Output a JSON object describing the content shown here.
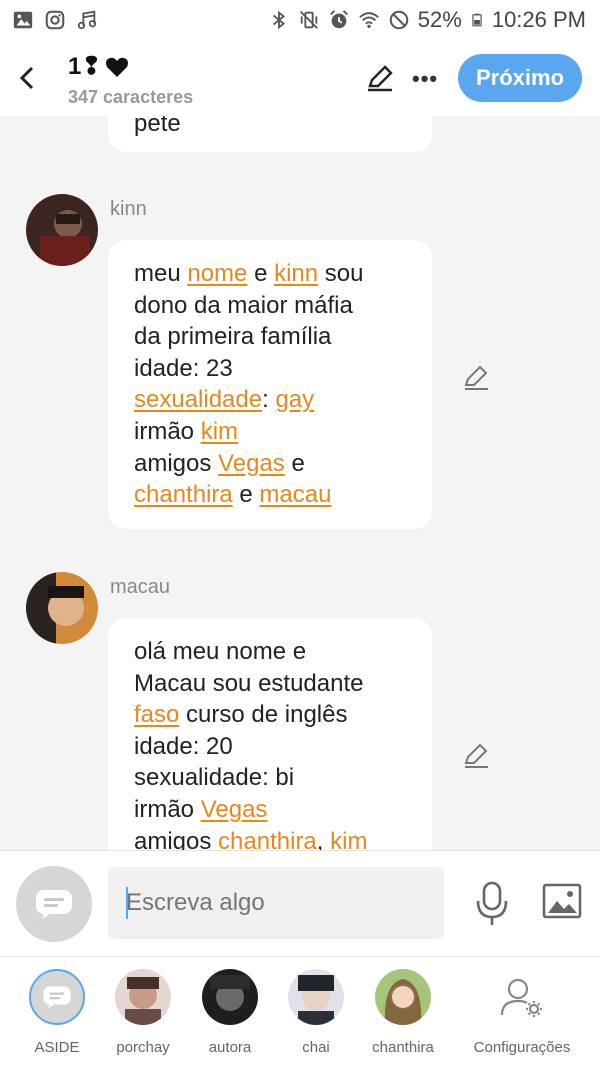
{
  "status_bar": {
    "battery": "52%",
    "time": "10:26 PM",
    "left_icons": [
      "image-icon",
      "instagram-icon",
      "music-icon"
    ],
    "right_icons": [
      "bluetooth-icon",
      "vibrate-icon",
      "alarm-icon",
      "wifi-icon",
      "no-disturb-icon",
      "battery-icon"
    ]
  },
  "header": {
    "title": "1❢",
    "subtitle": "347 caracteres",
    "next_label": "Próximo"
  },
  "messages": [
    {
      "author": "",
      "lines": [
        [
          {
            "t": "pete"
          }
        ]
      ]
    },
    {
      "author": "kinn",
      "lines": [
        [
          {
            "t": "meu "
          },
          {
            "t": "nome",
            "link": true
          },
          {
            "t": " e "
          },
          {
            "t": "kinn",
            "link": true
          },
          {
            "t": " sou"
          }
        ],
        [
          {
            "t": "dono da maior máfia"
          }
        ],
        [
          {
            "t": "da primeira família"
          }
        ],
        [
          {
            "t": "idade: 23"
          }
        ],
        [
          {
            "t": "sexualidade",
            "link": true
          },
          {
            "t": ": "
          },
          {
            "t": "gay",
            "link": true
          }
        ],
        [
          {
            "t": "irmão "
          },
          {
            "t": "kim",
            "link": true
          }
        ],
        [
          {
            "t": "amigos "
          },
          {
            "t": "Vegas",
            "link": true
          },
          {
            "t": " e"
          }
        ],
        [
          {
            "t": "chanthira",
            "link": true
          },
          {
            "t": " e "
          },
          {
            "t": "macau",
            "link": true
          }
        ]
      ]
    },
    {
      "author": "macau",
      "lines": [
        [
          {
            "t": "olá meu nome e"
          }
        ],
        [
          {
            "t": "Macau sou estudante"
          }
        ],
        [
          {
            "t": "faso",
            "link": true
          },
          {
            "t": " curso de inglês"
          }
        ],
        [
          {
            "t": "idade: 20"
          }
        ],
        [
          {
            "t": "sexualidade: bi"
          }
        ],
        [
          {
            "t": "irmão "
          },
          {
            "t": "Vegas",
            "link": true
          }
        ],
        [
          {
            "t": "amigos "
          },
          {
            "t": "chanthira",
            "link": true
          },
          {
            "t": ", "
          },
          {
            "t": "kim",
            "link": true
          }
        ]
      ]
    }
  ],
  "composer": {
    "placeholder": "Escreva algo"
  },
  "bottom_bar": [
    {
      "label": "ASIDE",
      "kind": "aside"
    },
    {
      "label": "porchay",
      "kind": "avatar",
      "color": "#6b4a4a"
    },
    {
      "label": "autora",
      "kind": "avatar",
      "color": "#3a3a3a"
    },
    {
      "label": "chai",
      "kind": "avatar",
      "color": "#2d2f3a"
    },
    {
      "label": "chanthira",
      "kind": "avatar",
      "color": "#c8a17a"
    },
    {
      "label": "Configurações",
      "kind": "settings"
    }
  ],
  "colors": {
    "accent": "#5aa7ef",
    "link": "#e8871e",
    "background": "#f4f4f4"
  }
}
